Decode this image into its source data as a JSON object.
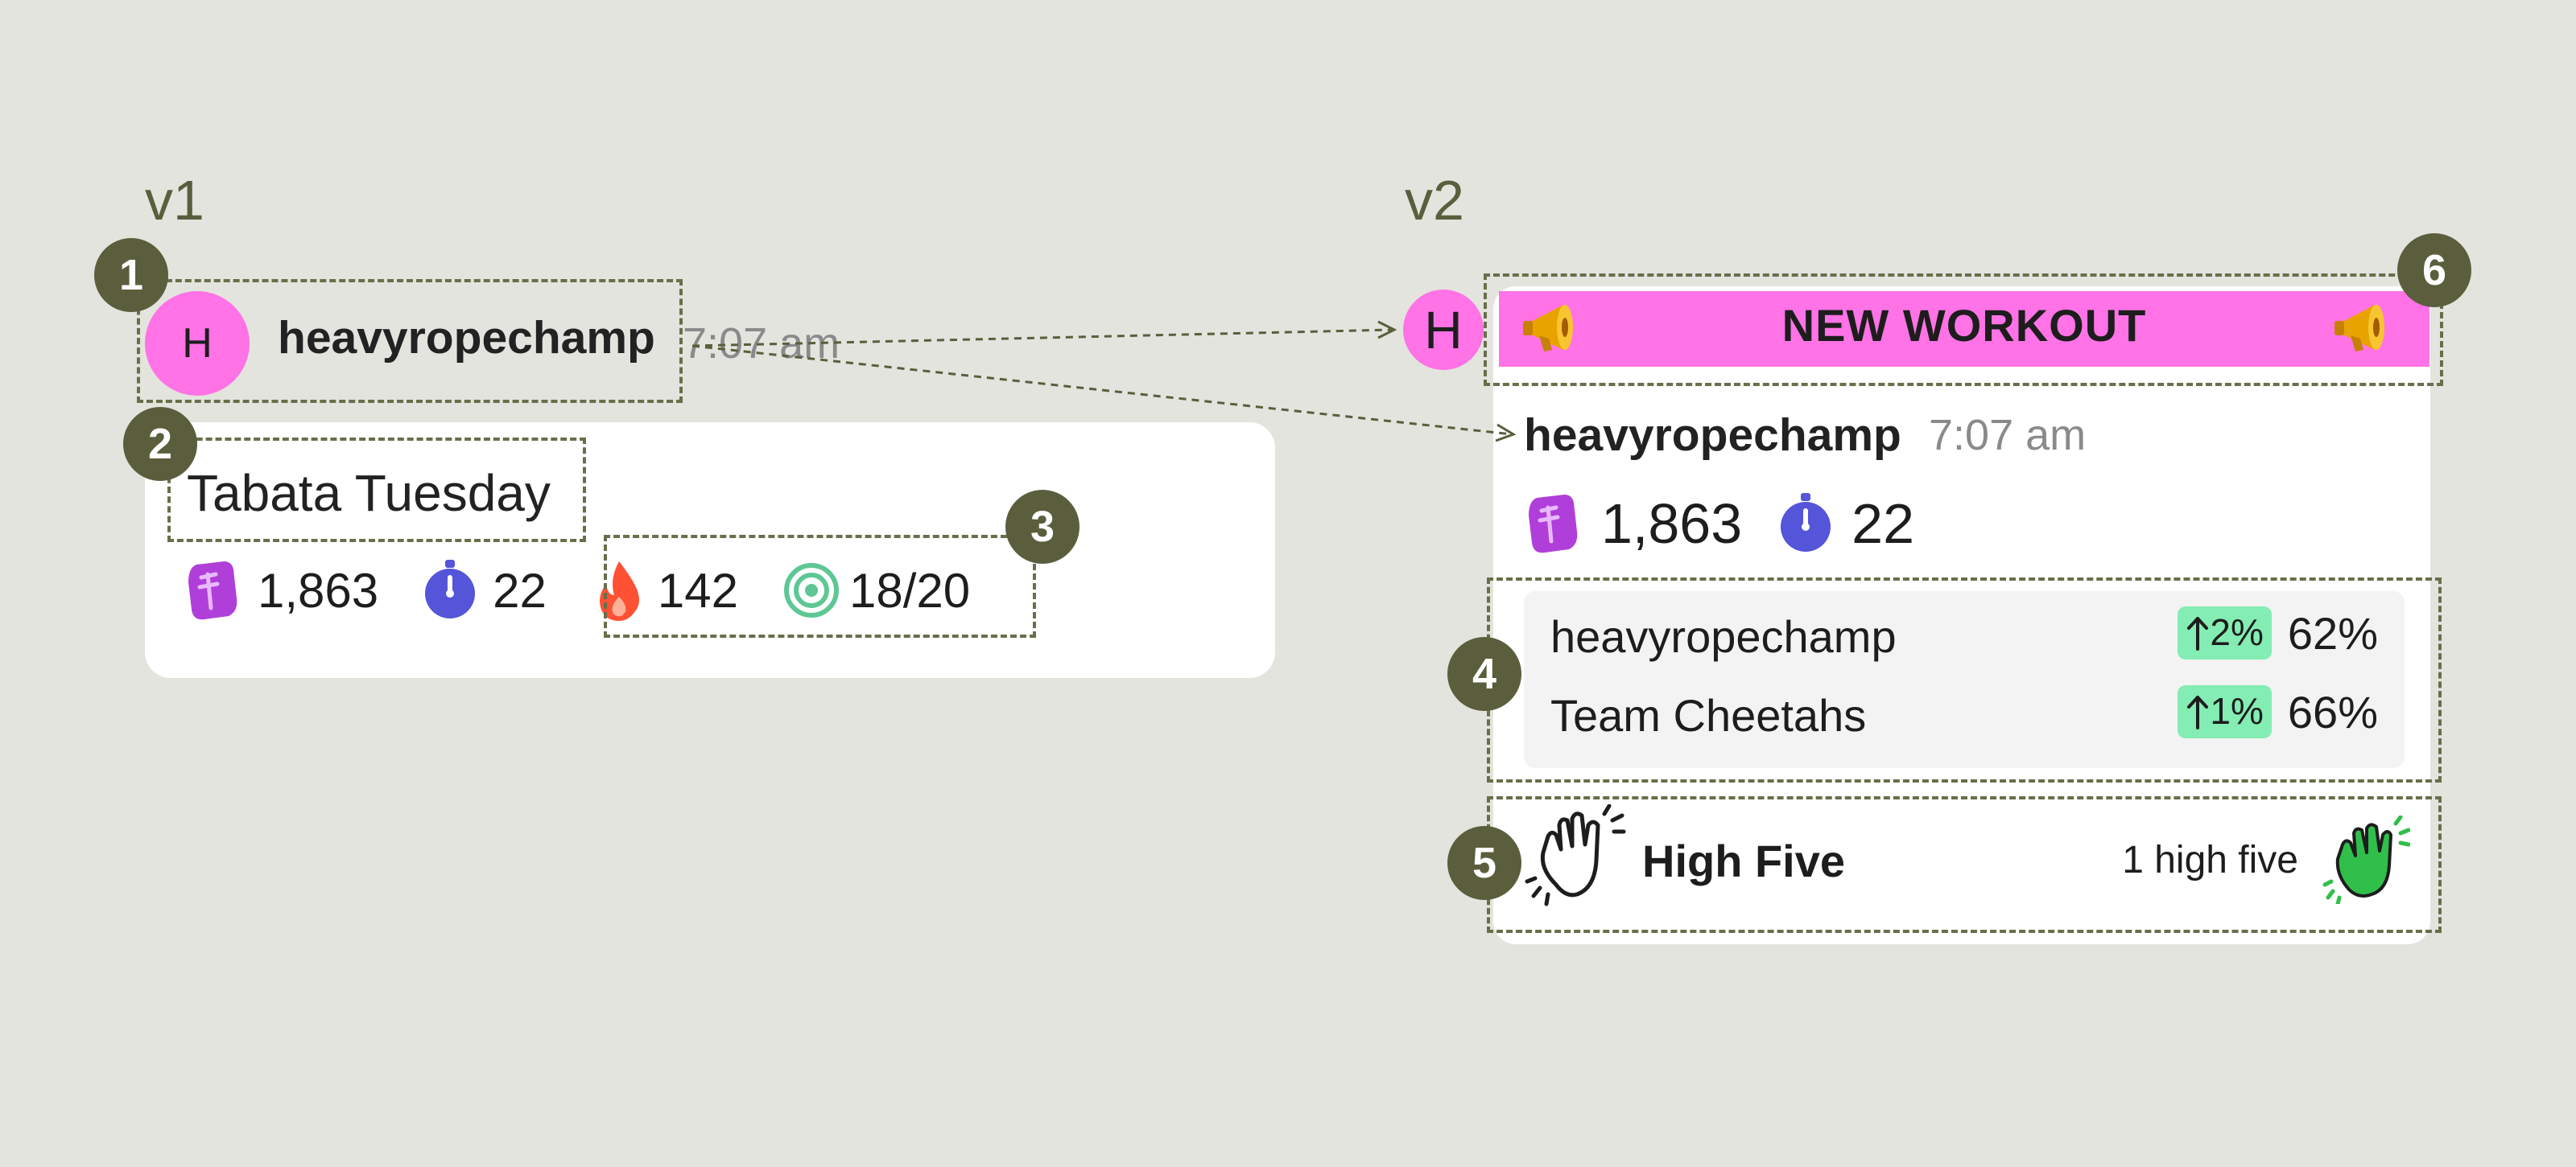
{
  "v1": {
    "label": "v1",
    "header": {
      "avatar_initial": "H",
      "username": "heavyropechamp",
      "time": "7:07 am"
    },
    "title": "Tabata Tuesday",
    "stats": [
      {
        "icon": "shoe-icon",
        "value": "1,863"
      },
      {
        "icon": "stopwatch-icon",
        "value": "22"
      },
      {
        "icon": "flame-icon",
        "value": "142"
      },
      {
        "icon": "target-icon",
        "value": "18/20"
      }
    ]
  },
  "v2": {
    "label": "v2",
    "banner": {
      "title": "NEW WORKOUT",
      "left_icon": "megaphone-icon",
      "right_icon": "megaphone-icon"
    },
    "avatar_initial": "H",
    "username": "heavyropechamp",
    "time": "7:07 am",
    "stats": [
      {
        "icon": "shoe-icon",
        "value": "1,863"
      },
      {
        "icon": "stopwatch-icon",
        "value": "22"
      }
    ],
    "comparison": [
      {
        "name": "heavyropechamp",
        "change": "2%",
        "value": "62%"
      },
      {
        "name": "Team Cheetahs",
        "change": "1%",
        "value": "66%"
      }
    ],
    "high_five": {
      "label": "High Five",
      "count_text": "1 high five"
    }
  },
  "callouts": [
    "1",
    "2",
    "3",
    "4",
    "5",
    "6"
  ],
  "colors": {
    "background": "#e3e4de",
    "accent_pink": "#ff73e6",
    "callout": "#5a5e3c",
    "pill_green": "#83edb3",
    "stopwatch": "#5555d9",
    "shoe": "#b03fd9",
    "flame": "#ff5133",
    "target": "#5ec794"
  }
}
